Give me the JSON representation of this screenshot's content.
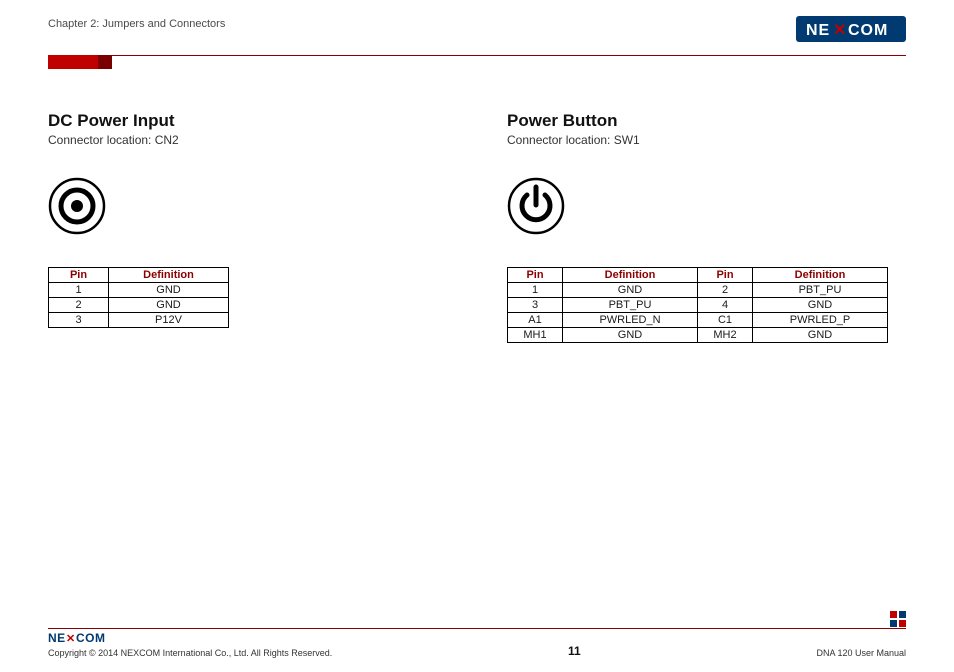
{
  "header": {
    "breadcrumb": "Chapter 2: Jumpers and Connectors",
    "logo_text": "NEXCOM"
  },
  "left": {
    "title": "DC Power Input",
    "subtitle": "Connector location: CN2",
    "table": {
      "headers": [
        "Pin",
        "Definition"
      ],
      "rows": [
        [
          "1",
          "GND"
        ],
        [
          "2",
          "GND"
        ],
        [
          "3",
          "P12V"
        ]
      ]
    }
  },
  "right": {
    "title": "Power Button",
    "subtitle": "Connector location: SW1",
    "table": {
      "headers": [
        "Pin",
        "Definition",
        "Pin",
        "Definition"
      ],
      "rows": [
        [
          "1",
          "GND",
          "2",
          "PBT_PU"
        ],
        [
          "3",
          "PBT_PU",
          "4",
          "GND"
        ],
        [
          "A1",
          "PWRLED_N",
          "C1",
          "PWRLED_P"
        ],
        [
          "MH1",
          "GND",
          "MH2",
          "GND"
        ]
      ]
    }
  },
  "footer": {
    "logo_text": "NEXCOM",
    "copyright": "Copyright © 2014 NEXCOM International Co., Ltd. All Rights Reserved.",
    "page": "11",
    "doc": "DNA 120 User Manual"
  }
}
